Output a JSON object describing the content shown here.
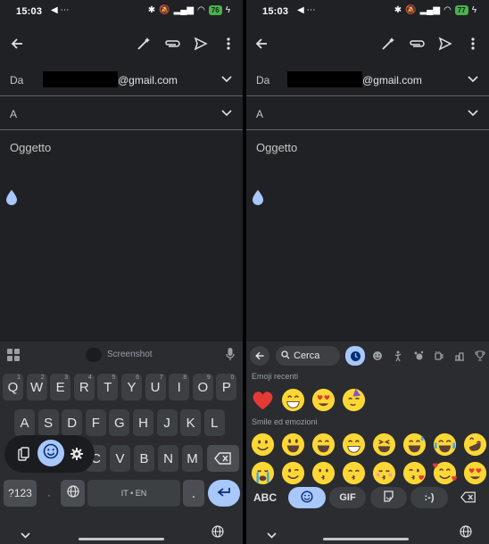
{
  "status": {
    "time_left": "15:03",
    "time_right": "15:03",
    "battery_left": "76",
    "battery_right": "77"
  },
  "compose": {
    "from_label": "Da",
    "from_email": "@gmail.com",
    "to_label": "A",
    "subject_placeholder": "Oggetto"
  },
  "keyboard": {
    "suggestion": "Screenshot",
    "row1": [
      {
        "k": "Q",
        "h": "1"
      },
      {
        "k": "W",
        "h": "2"
      },
      {
        "k": "E",
        "h": "3"
      },
      {
        "k": "R",
        "h": "4"
      },
      {
        "k": "T",
        "h": "5"
      },
      {
        "k": "Y",
        "h": "6"
      },
      {
        "k": "U",
        "h": "7"
      },
      {
        "k": "I",
        "h": "8"
      },
      {
        "k": "O",
        "h": "9"
      },
      {
        "k": "P",
        "h": "0"
      }
    ],
    "row2": [
      "A",
      "S",
      "D",
      "F",
      "G",
      "H",
      "J",
      "K",
      "L"
    ],
    "row3": [
      "C",
      "V",
      "B",
      "N",
      "M"
    ],
    "sym_label": "?123",
    "space_label": "IT • EN",
    "period": "."
  },
  "emoji_keyboard": {
    "search_label": "Cerca",
    "recent_title": "Emoji recenti",
    "smileys_title": "Smile ed emozioni",
    "abc_label": "ABC",
    "gif_label": "GIF",
    "emoticon_label": ":-)"
  },
  "colors": {
    "accent": "#a8c7fa",
    "background": "#202124",
    "keyboard": "#2a2c30",
    "key": "#3c4043"
  },
  "icons": [
    "back-arrow-icon",
    "magic-pen-icon",
    "attach-icon",
    "send-icon",
    "more-vert-icon",
    "chevron-down-icon",
    "mic-icon",
    "emoji-icon",
    "clipboard-icon",
    "gear-icon",
    "globe-icon",
    "backspace-icon",
    "enter-icon",
    "search-icon",
    "clock-icon"
  ]
}
